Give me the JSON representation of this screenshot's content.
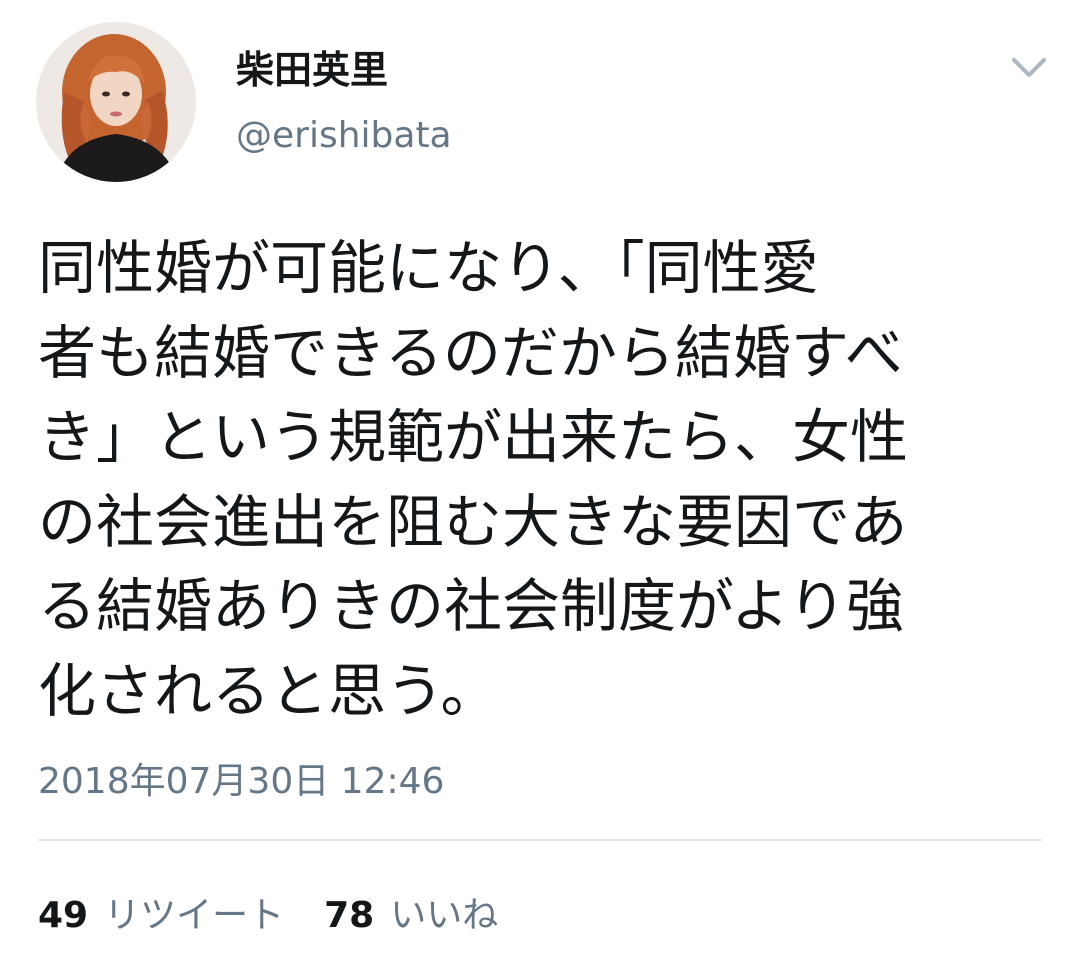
{
  "author": {
    "display_name": "柴田英里",
    "handle": "@erishibata",
    "avatar_icon": "profile-photo"
  },
  "tweet": {
    "lines": [
      "同性婚が可能になり、「同性愛",
      "者も結婚できるのだから結婚すべ",
      "き」という規範が出来たら、女性",
      "の社会進出を阻む大きな要因であ",
      "る結婚ありきの社会制度がより強",
      "化されると思う。"
    ],
    "timestamp": "2018年07月30日 12:46"
  },
  "stats": {
    "retweets": {
      "count": "49",
      "label": "リツイート"
    },
    "likes": {
      "count": "78",
      "label": "いいね"
    }
  },
  "menu": {
    "icon": "chevron-down-icon"
  },
  "colors": {
    "text": "#14171a",
    "secondary": "#657786",
    "divider": "#e1e8ed"
  }
}
